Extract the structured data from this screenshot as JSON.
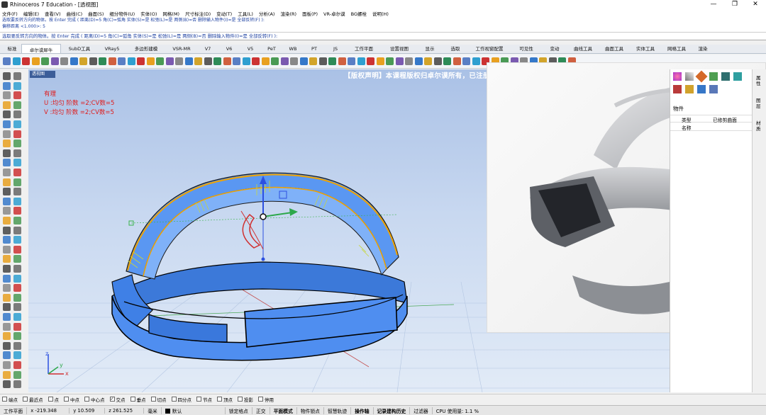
{
  "window": {
    "title": "Rhinoceros 7 Education - [透视图]",
    "minimize": "—",
    "restore": "❐",
    "close": "✕"
  },
  "menu": [
    "文件(F)",
    "编辑(E)",
    "查看(V)",
    "曲线(C)",
    "曲面(S)",
    "细分物件(U)",
    "实体(O)",
    "网格(M)",
    "尺寸标注(D)",
    "变动(T)",
    "工具(L)",
    "分析(A)",
    "渲染(R)",
    "面板(P)",
    "VR-卓尔谟",
    "BG螺栓",
    "说明(H)"
  ],
  "command": {
    "history_line1": "选取要反转方向的物体。按 Enter 完成 ( 距离(D)=5  角(C)=弧角  实体(S)=是  松弛(L)=是  两侧(B)=否  删除输入物件(I)=是  全部反转(F) ):",
    "history_line2": "偏移距离 <1.000>: 5",
    "prompt": "选取要反转方向的物体。按 Enter 完成 ( 距离(D)=5  角(C)=弧角  实体(S)=是  松弛(L)=是  两侧(B)=否  删除输入物件(I)=是  全部反转(F) ):"
  },
  "tabs": [
    "标准",
    "卓尔谟犀牛",
    "SubD工具",
    "VRay5",
    "多边形建模",
    "VSR-MR",
    "V7",
    "V6",
    "V5",
    "PeT",
    "WB",
    "PT",
    "JS",
    "工作平面",
    "设置视图",
    "显示",
    "选取",
    "工作视窗配置",
    "可见性",
    "变动",
    "曲线工具",
    "曲面工具",
    "实体工具",
    "网格工具",
    "渲染"
  ],
  "active_tab_index": 1,
  "viewport": {
    "tab_label": "透视图",
    "copyright": "【版权声明】本课程版权归卓尔谟所有，已注册课程版权专利，盗版必究!",
    "annotation": {
      "line1": "有理",
      "line2": "U :均匀  阶数 =2;CV数=5",
      "line3": "V :均匀  阶数 =2;CV数=5"
    },
    "axis_labels": {
      "x": "x",
      "y": "y",
      "z": "z"
    }
  },
  "properties_panel": {
    "header": "物件",
    "rows": [
      {
        "label": "类型",
        "value": "已修剪曲面"
      },
      {
        "label": "名称",
        "value": ""
      }
    ],
    "side_tabs": [
      "属性",
      "图层",
      "材质"
    ]
  },
  "osnaps": [
    {
      "label": "端点",
      "checked": false
    },
    {
      "label": "最近点",
      "checked": false
    },
    {
      "label": "点",
      "checked": false
    },
    {
      "label": "中点",
      "checked": false
    },
    {
      "label": "中心点",
      "checked": false
    },
    {
      "label": "交点",
      "checked": true
    },
    {
      "label": "垂点",
      "checked": false
    },
    {
      "label": "切点",
      "checked": false
    },
    {
      "label": "四分点",
      "checked": false
    },
    {
      "label": "节点",
      "checked": false
    },
    {
      "label": "顶点",
      "checked": false
    },
    {
      "label": "投影",
      "checked": false
    },
    {
      "label": "停用",
      "checked": false
    }
  ],
  "status": {
    "cplane": "工作平面",
    "x": "x -219.348",
    "y": "y 10.509",
    "z": "z 261.525",
    "units": "毫米",
    "layer": "默认",
    "grid_snap": "锁定格点",
    "ortho": "正交",
    "planar": "平面模式",
    "osnap": "物件锁点",
    "smarttrack": "智慧轨迹",
    "gumball": "操作轴",
    "history": "记录建构历史",
    "filter": "过滤器",
    "cpu": "CPU 使用量: 1.1 %"
  },
  "colors": {
    "model_blue": "#4f8ef0",
    "edge_orange": "#f0a300",
    "annotation_red": "#e01c1c",
    "copyright_white": "#ffffff"
  }
}
